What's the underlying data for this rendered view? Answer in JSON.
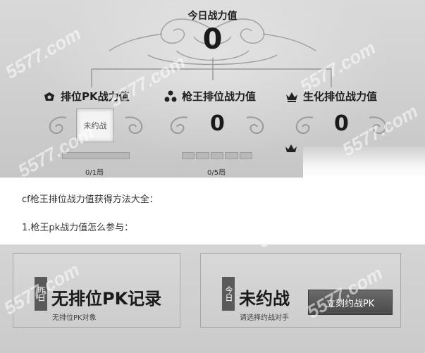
{
  "today": {
    "title": "今日战力值",
    "value": "0"
  },
  "columns": [
    {
      "title": "排位PK战力值",
      "icon": "ranked-pk-icon",
      "value_label": "未约战",
      "progress_text": "0/1局",
      "progress": 0
    },
    {
      "title": "枪王排位战力值",
      "icon": "sniper-rank-icon",
      "value": "0",
      "progress_text": "0/5局",
      "progress": 0
    },
    {
      "title": "生化排位战力值",
      "icon": "crown-icon",
      "value": "0"
    }
  ],
  "article": {
    "line1": "cf枪王排位战力值获得方法大全：",
    "line2": "1.枪王pk战力值怎么参与："
  },
  "cards": {
    "yesterday": {
      "tag": "昨日",
      "headline": "无排位PK记录",
      "sub": "无排位PK对象"
    },
    "today": {
      "tag": "今日",
      "headline": "未约战",
      "sub": "请选择约战对手",
      "button": "立刻约战PK"
    }
  },
  "watermark": "5577.com",
  "colors": {
    "panel_bg": "#cfcfcf",
    "button_bg": "#555555",
    "tag_bg": "#5a5a5a"
  }
}
